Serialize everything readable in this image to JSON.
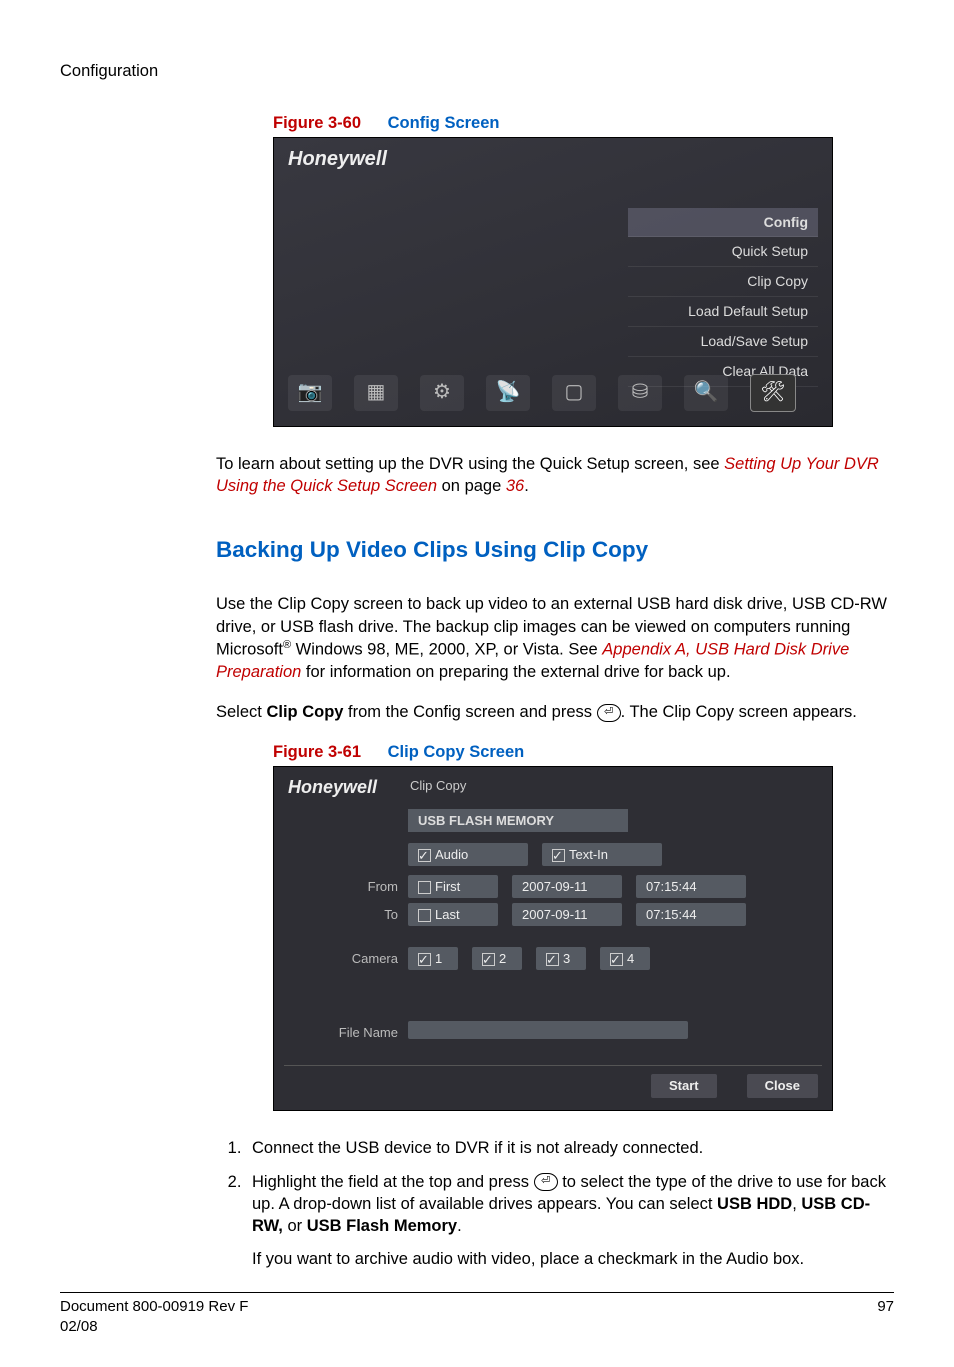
{
  "header": {
    "section": "Configuration"
  },
  "figure60": {
    "num": "Figure 3-60",
    "title": "Config Screen"
  },
  "fig60_ui": {
    "brand": "Honeywell",
    "menu": [
      {
        "label": "Config",
        "selected": true
      },
      {
        "label": "Quick Setup",
        "selected": false
      },
      {
        "label": "Clip Copy",
        "selected": false
      },
      {
        "label": "Load Default Setup",
        "selected": false
      },
      {
        "label": "Load/Save Setup",
        "selected": false
      },
      {
        "label": "Clear All Data",
        "selected": false
      }
    ],
    "icons": [
      "camera-icon",
      "layout-icon",
      "gear-icon",
      "network-icon",
      "display-icon",
      "storage-icon",
      "event-icon",
      "tools-icon"
    ]
  },
  "para_after_fig60_a": "To learn about setting up the DVR using the Quick Setup screen, see ",
  "para_after_fig60_link": "Setting Up Your DVR Using the Quick Setup Screen",
  "para_after_fig60_b": " on page ",
  "para_after_fig60_page": "36",
  "para_after_fig60_c": ".",
  "heading_backup": "Backing Up Video Clips Using Clip Copy",
  "backup_para1_a": "Use the Clip Copy screen to back up video to an external USB hard disk drive, USB CD-RW drive, or USB flash drive. The backup clip images can be viewed on computers running Microsoft",
  "backup_para1_reg": "®",
  "backup_para1_b": " Windows 98, ME, 2000, XP, or Vista. See ",
  "backup_para1_link": "Appendix A, USB Hard Disk Drive Preparation",
  "backup_para1_c": " for information on preparing the external drive for back up.",
  "backup_para2_a": "Select ",
  "backup_para2_bold": "Clip Copy",
  "backup_para2_b": " from the Config screen and press ",
  "backup_para2_c": ". The Clip Copy screen appears.",
  "figure61": {
    "num": "Figure 3-61",
    "title": "Clip Copy Screen"
  },
  "fig61_ui": {
    "brand": "Honeywell",
    "window_title": "Clip Copy",
    "drive": "USB FLASH MEMORY",
    "audio_label": "Audio",
    "textin_label": "Text-In",
    "from_label": "From",
    "to_label": "To",
    "camera_label": "Camera",
    "filename_label": "File Name",
    "from_first": "First",
    "from_date": "2007-09-11",
    "from_time": "07:15:44",
    "to_last": "Last",
    "to_date": "2007-09-11",
    "to_time": "07:15:44",
    "cam1": "1",
    "cam2": "2",
    "cam3": "3",
    "cam4": "4",
    "start_btn": "Start",
    "close_btn": "Close"
  },
  "step1": "Connect the USB device to DVR if it is not already connected.",
  "step2_a": "Highlight the field at the top and press ",
  "step2_b": "  to select the type of the drive to use for back up. A drop-down list of available drives appears. You can select ",
  "step2_bold1": "USB HDD",
  "step2_sep1": ", ",
  "step2_bold2": "USB CD-RW,",
  "step2_sep2": " or ",
  "step2_bold3": "USB Flash Memory",
  "step2_c": ".",
  "step2_sub": "If you want to archive audio with video, place a checkmark in the Audio box.",
  "footer": {
    "doc": "Document 800-00919 Rev F",
    "date": "02/08",
    "page": "97"
  }
}
